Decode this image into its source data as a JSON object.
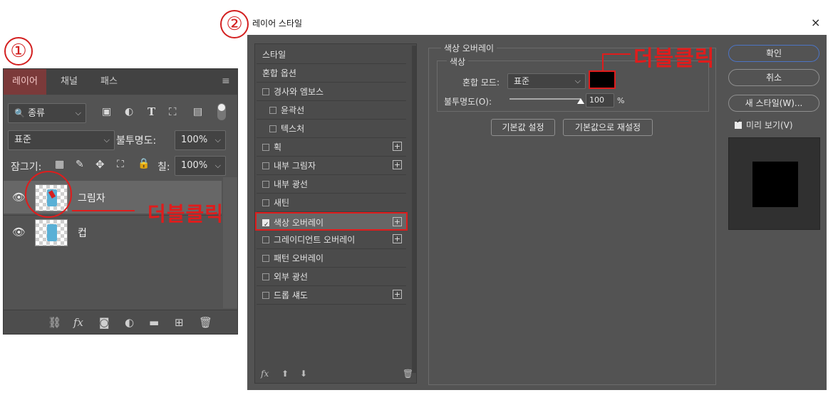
{
  "steps": [
    "①",
    "②"
  ],
  "layers_panel": {
    "tabs": [
      "레이어",
      "채널",
      "패스"
    ],
    "filter_kind": "종류",
    "blend_mode": "표준",
    "opacity_label": "불투명도:",
    "opacity_value": "100%",
    "lock_label": "잠그기:",
    "fill_label": "칠:",
    "fill_value": "100%",
    "layers": [
      {
        "name": "그림자",
        "selected": true
      },
      {
        "name": "컵",
        "selected": false
      }
    ],
    "double_click_label": "더블클릭",
    "bottom_icons": [
      "link-icon",
      "fx-icon",
      "mask-icon",
      "adjustment-icon",
      "folder-icon",
      "new-layer-icon",
      "trash-icon"
    ]
  },
  "dialog": {
    "title": "레이어 스타일",
    "close": "×",
    "style_list": [
      {
        "label": "스타일",
        "checkbox": false,
        "plus": false,
        "indent": false
      },
      {
        "label": "혼합 옵션",
        "checkbox": false,
        "plus": false,
        "indent": false
      },
      {
        "label": "경사와 엠보스",
        "checkbox": true,
        "checked": false,
        "plus": false,
        "indent": false
      },
      {
        "label": "윤곽선",
        "checkbox": true,
        "checked": false,
        "plus": false,
        "indent": true
      },
      {
        "label": "텍스처",
        "checkbox": true,
        "checked": false,
        "plus": false,
        "indent": true
      },
      {
        "label": "획",
        "checkbox": true,
        "checked": false,
        "plus": true,
        "indent": false
      },
      {
        "label": "내부 그림자",
        "checkbox": true,
        "checked": false,
        "plus": true,
        "indent": false
      },
      {
        "label": "내부 광선",
        "checkbox": true,
        "checked": false,
        "plus": false,
        "indent": false
      },
      {
        "label": "새틴",
        "checkbox": true,
        "checked": false,
        "plus": false,
        "indent": false
      },
      {
        "label": "색상 오버레이",
        "checkbox": true,
        "checked": true,
        "plus": true,
        "indent": false,
        "selected": true
      },
      {
        "label": "그레이디언트 오버레이",
        "checkbox": true,
        "checked": false,
        "plus": true,
        "indent": false
      },
      {
        "label": "패턴 오버레이",
        "checkbox": true,
        "checked": false,
        "plus": false,
        "indent": false
      },
      {
        "label": "외부 광선",
        "checkbox": true,
        "checked": false,
        "plus": false,
        "indent": false
      },
      {
        "label": "드롭 섀도",
        "checkbox": true,
        "checked": false,
        "plus": true,
        "indent": false
      }
    ],
    "list_footer_fx": "fx",
    "section_title": "색상 오버레이",
    "subsection_title": "색상",
    "blend_mode_label": "혼합 모드:",
    "blend_mode_value": "표준",
    "swatch_color": "#000000",
    "opacity_label": "불투명도(O):",
    "opacity_value": "100",
    "opacity_level": 1.0,
    "percent": "%",
    "btn_default": "기본값 설정",
    "btn_reset": "기본값으로 재설정",
    "btn_ok": "확인",
    "btn_cancel": "취소",
    "btn_new_style": "새 스타일(W)...",
    "preview_label": "미리 보기(V)",
    "preview_checked": true,
    "double_click_label": "더블클릭"
  },
  "colors": {
    "accent_red": "#e01c1c",
    "panel_bg": "#535353"
  }
}
